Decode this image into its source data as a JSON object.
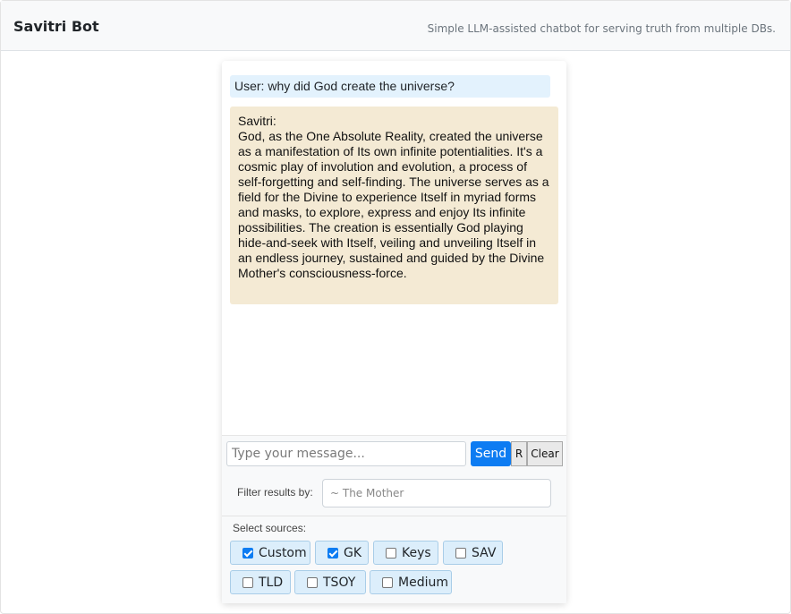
{
  "header": {
    "title": "Savitri Bot",
    "subtitle": "Simple LLM-assisted chatbot for serving truth from multiple DBs."
  },
  "chat": {
    "user_message": "User: why did God create the universe?",
    "bot_message": "Savitri:\nGod, as the One Absolute Reality, created the universe as a manifestation of Its own infinite potentialities. It's a cosmic play of involution and evolution, a process of self-forgetting and self-finding. The universe serves as a field for the Divine to experience Itself in myriad forms and masks, to explore, express and enjoy Its infinite possibilities. The creation is essentially God playing hide-and-seek with Itself, veiling and unveiling Itself in an endless journey, sustained and guided by the Divine Mother's consciousness-force."
  },
  "input": {
    "placeholder": "Type your message...",
    "send_label": "Send",
    "r_label": "R",
    "clear_label": "Clear"
  },
  "filter": {
    "label": "Filter results by:",
    "placeholder": "~ The Mother"
  },
  "sources": {
    "label": "Select sources:",
    "items": [
      {
        "label": "Custom",
        "checked": true
      },
      {
        "label": "GK",
        "checked": true
      },
      {
        "label": "Keys",
        "checked": false
      },
      {
        "label": "SAV",
        "checked": false
      },
      {
        "label": "TLD",
        "checked": false
      },
      {
        "label": "TSOY",
        "checked": false
      },
      {
        "label": "Medium",
        "checked": false
      }
    ]
  },
  "colors": {
    "accent": "#0d7cf2",
    "user_bubble": "#e3f2fd",
    "bot_bubble": "#f4ead4",
    "chip_bg": "#dceefb"
  }
}
